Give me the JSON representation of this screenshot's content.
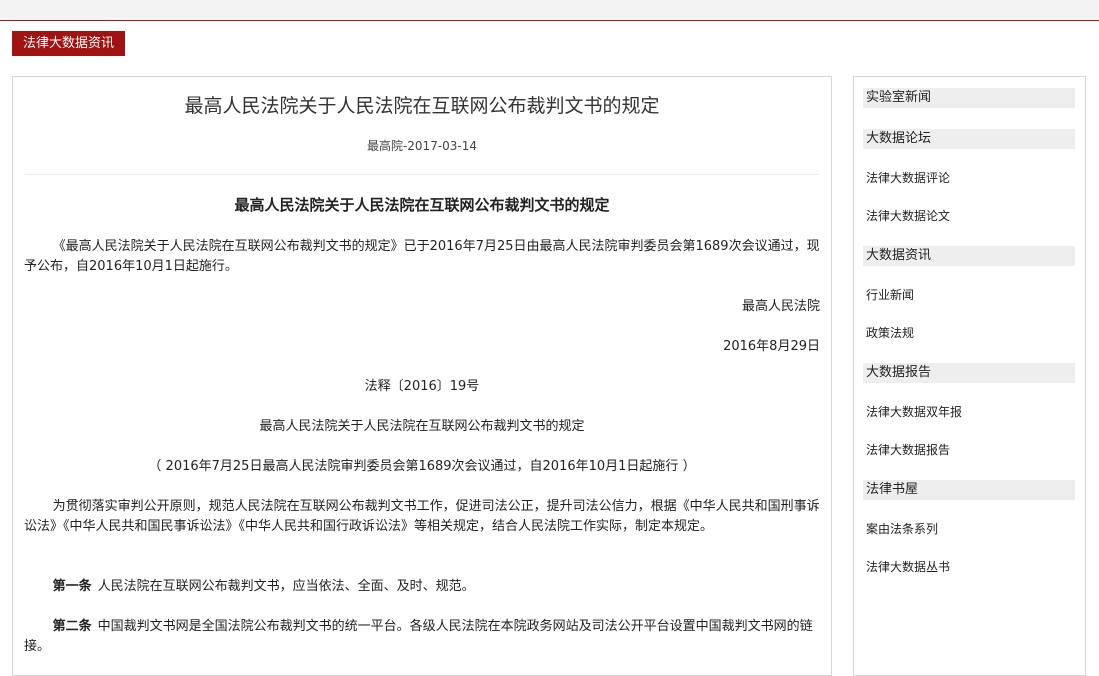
{
  "section_tab": "法律大数据资讯",
  "article": {
    "title": "最高人民法院关于人民法院在互联网公布裁判文书的规定",
    "meta": "最高院-2017-03-14",
    "subtitle": "最高人民法院关于人民法院在互联网公布裁判文书的规定",
    "intro": "《最高人民法院关于人民法院在互联网公布裁判文书的规定》已于2016年7月25日由最高人民法院审判委员会第1689次会议通过，现予公布，自2016年10月1日起施行。",
    "issuer": "最高人民法院",
    "date": "2016年8月29日",
    "doc_number": "法释〔2016〕19号",
    "title_again": "最高人民法院关于人民法院在互联网公布裁判文书的规定",
    "adoption_note": "（ 2016年7月25日最高人民法院审判委员会第1689次会议通过，自2016年10月1日起施行 ）",
    "preamble": "为贯彻落实审判公开原则，规范人民法院在互联网公布裁判文书工作，促进司法公正，提升司法公信力，根据《中华人民共和国刑事诉讼法》《中华人民共和国民事诉讼法》《中华人民共和国行政诉讼法》等相关规定，结合人民法院工作实际，制定本规定。",
    "article1_label": "第一条",
    "article1_text": "人民法院在互联网公布裁判文书，应当依法、全面、及时、规范。",
    "article2_label": "第二条",
    "article2_text": "中国裁判文书网是全国法院公布裁判文书的统一平台。各级人民法院在本院政务网站及司法公开平台设置中国裁判文书网的链接。"
  },
  "sidebar": {
    "sections": [
      {
        "heading": "实验室新闻",
        "links": []
      },
      {
        "heading": "大数据论坛",
        "links": [
          "法律大数据评论",
          "法律大数据论文"
        ]
      },
      {
        "heading": "大数据资讯",
        "links": [
          "行业新闻",
          "政策法规"
        ]
      },
      {
        "heading": "大数据报告",
        "links": [
          "法律大数据双年报",
          "法律大数据报告"
        ]
      },
      {
        "heading": "法律书屋",
        "links": [
          "案由法条系列",
          "法律大数据丛书"
        ]
      }
    ]
  }
}
